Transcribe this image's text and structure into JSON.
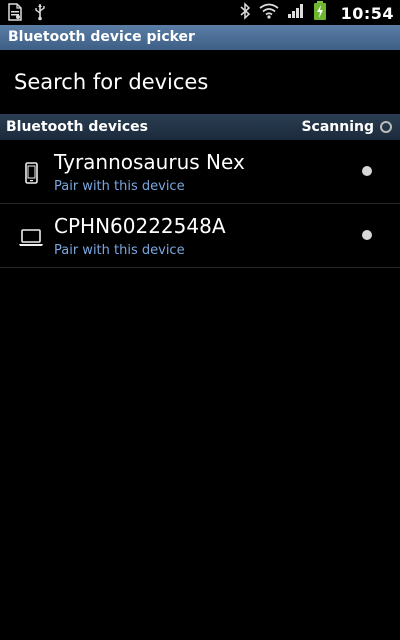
{
  "status_bar": {
    "time": "10:54",
    "icons_left": [
      "document-icon",
      "usb-icon"
    ],
    "icons_right": [
      "bluetooth-icon",
      "wifi-icon",
      "signal-icon",
      "battery-charging-icon"
    ]
  },
  "title_bar": {
    "title": "Bluetooth device picker"
  },
  "search": {
    "label": "Search for devices"
  },
  "section": {
    "title": "Bluetooth devices",
    "status": "Scanning"
  },
  "devices": [
    {
      "name": "Tyrannosaurus Nex",
      "subtitle": "Pair with this device",
      "icon": "phone-icon"
    },
    {
      "name": "CPHN60222548A",
      "subtitle": "Pair with this device",
      "icon": "laptop-icon"
    }
  ],
  "colors": {
    "title_bar": "#4a6d96",
    "section_header": "#22344a",
    "subtitle_text": "#7aa7e0",
    "background": "#000000"
  }
}
